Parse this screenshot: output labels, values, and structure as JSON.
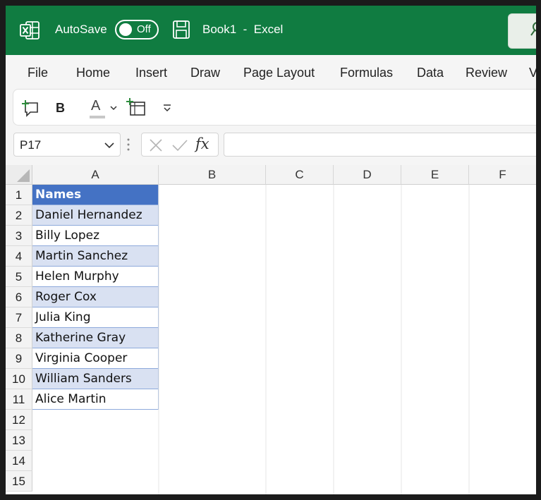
{
  "titlebar": {
    "autosave_label": "AutoSave",
    "autosave_state": "Off",
    "document_title": "Book1  -  Excel",
    "icons": [
      "excel-logo-icon",
      "save-icon",
      "search-icon"
    ]
  },
  "menu": {
    "items": [
      "File",
      "Home",
      "Insert",
      "Draw",
      "Page Layout",
      "Formulas",
      "Data",
      "Review",
      "V"
    ]
  },
  "toolbar": {
    "buttons": [
      "new-comment-icon",
      "bold-icon",
      "font-color-icon",
      "font-color-dropdown-icon",
      "insert-table-icon",
      "customize-toolbar-icon"
    ],
    "bold_label": "B",
    "font_color_label": "A"
  },
  "formula_bar": {
    "name_box_value": "P17",
    "fx_label": "fx",
    "formula_value": ""
  },
  "sheet": {
    "columns": [
      "A",
      "B",
      "C",
      "D",
      "E",
      "F"
    ],
    "rows": [
      "1",
      "2",
      "3",
      "4",
      "5",
      "6",
      "7",
      "8",
      "9",
      "10",
      "11",
      "12",
      "13",
      "14",
      "15"
    ],
    "column_a": [
      "Names",
      "Daniel Hernandez",
      "Billy Lopez",
      "Martin Sanchez",
      "Helen Murphy",
      "Roger Cox",
      "Julia King",
      "Katherine Gray",
      "Virginia Cooper",
      "William Sanders",
      "Alice Martin"
    ]
  },
  "colors": {
    "titlebar_bg": "#107c41",
    "table_header_bg": "#4472c4",
    "table_band_bg": "#d9e1f2",
    "table_border": "#8eaadb"
  }
}
